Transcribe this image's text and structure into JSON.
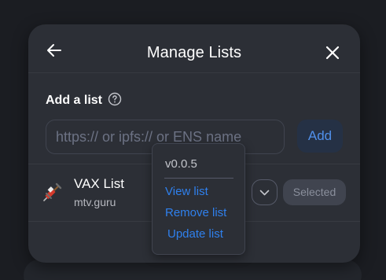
{
  "header": {
    "title": "Manage Lists"
  },
  "add_list": {
    "label": "Add a list",
    "input_placeholder": "https:// or ipfs:// or ENS name",
    "input_value": "",
    "add_button": "Add"
  },
  "lists": [
    {
      "name": "VAX List",
      "url": "mtv.guru",
      "logo_icon": "syringe-icon",
      "status_button": "Selected"
    }
  ],
  "popover": {
    "version": "v0.0.5",
    "items": [
      "View list",
      "Remove list",
      "Update list"
    ]
  },
  "colors": {
    "background": "#1b1d22",
    "modal": "#2c2f36",
    "accent": "#2f80ed",
    "add_button_bg": "#253145",
    "selected_bg": "#40444f"
  }
}
